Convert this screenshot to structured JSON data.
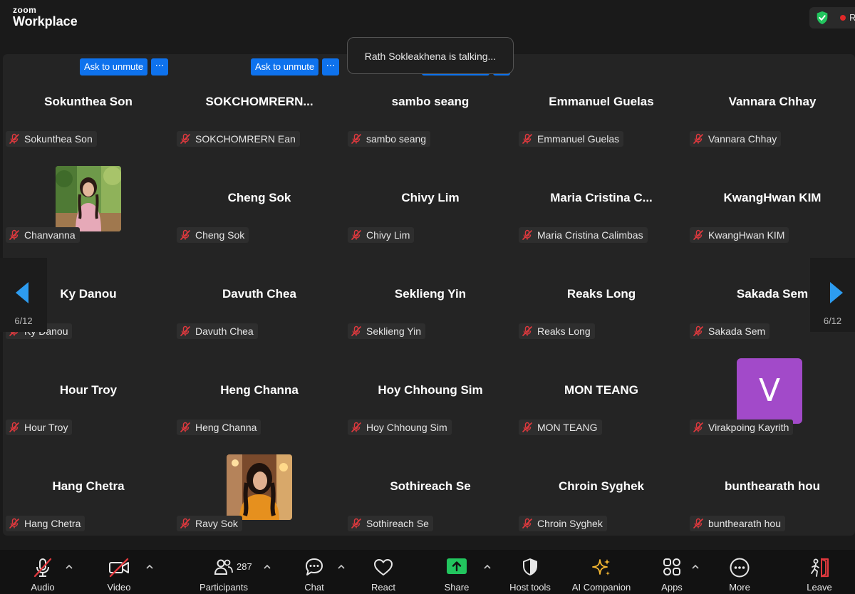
{
  "app": {
    "brand": "zoom",
    "product": "Workplace"
  },
  "colors": {
    "accent": "#0e72ed",
    "muted_mic": "#e0393e",
    "share": "#22c55e",
    "shield": "#22c55e",
    "avatar_v": "#a24ac9",
    "record_dot": "#e02828"
  },
  "status": {
    "talking": "Rath Sokleakhena is talking..."
  },
  "controls": {
    "ask_unmute_label": "Ask to unmute",
    "more_label": "⋯"
  },
  "paging": {
    "page": "6/12"
  },
  "tiles": [
    {
      "name": "Sokunthea Son",
      "label": "Sokunthea Son"
    },
    {
      "name": "SOKCHOMRERN...",
      "label": "SOKCHOMRERN Ean"
    },
    {
      "name": "sambo seang",
      "label": "sambo seang"
    },
    {
      "name": "Emmanuel Guelas",
      "label": "Emmanuel Guelas"
    },
    {
      "name": "Vannara Chhay",
      "label": "Vannara Chhay"
    },
    {
      "name": "",
      "label": "Chanvanna"
    },
    {
      "name": "Cheng Sok",
      "label": "Cheng Sok"
    },
    {
      "name": "Chivy Lim",
      "label": "Chivy Lim"
    },
    {
      "name": "Maria  Cristina  C...",
      "label": "Maria Cristina Calimbas"
    },
    {
      "name": "KwangHwan KIM",
      "label": "KwangHwan KIM"
    },
    {
      "name": "Ky Danou",
      "label": "Ky Danou"
    },
    {
      "name": "Davuth Chea",
      "label": "Davuth Chea"
    },
    {
      "name": "Seklieng Yin",
      "label": "Seklieng Yin"
    },
    {
      "name": "Reaks Long",
      "label": "Reaks Long"
    },
    {
      "name": "Sakada Sem",
      "label": "Sakada Sem"
    },
    {
      "name": "Hour Troy",
      "label": "Hour Troy"
    },
    {
      "name": "Heng Channa",
      "label": "Heng Channa"
    },
    {
      "name": "Hoy Chhoung Sim",
      "label": "Hoy Chhoung Sim"
    },
    {
      "name": "MON TEANG",
      "label": "MON TEANG"
    },
    {
      "name": "",
      "label": "Virakpoing Kayrith",
      "avatar": "V"
    },
    {
      "name": "Hang Chetra",
      "label": "Hang Chetra"
    },
    {
      "name": "",
      "label": "Ravy Sok"
    },
    {
      "name": "Sothireach Se",
      "label": "Sothireach Se"
    },
    {
      "name": "Chroin Syghek",
      "label": "Chroin Syghek"
    },
    {
      "name": "bunthearath hou",
      "label": "bunthearath hou"
    }
  ],
  "toolbar": {
    "audio": "Audio",
    "video": "Video",
    "participants": "Participants",
    "participants_count": "287",
    "chat": "Chat",
    "react": "React",
    "share": "Share",
    "host_tools": "Host tools",
    "ai_companion": "AI Companion",
    "apps": "Apps",
    "more": "More",
    "leave": "Leave"
  }
}
